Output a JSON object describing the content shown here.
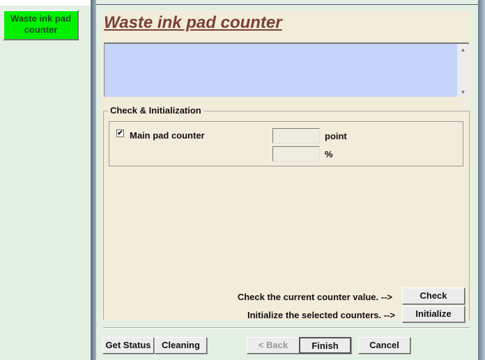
{
  "sidebar": {
    "waste_ink_button": "Waste ink pad counter"
  },
  "dialog": {
    "title": "Waste ink pad counter",
    "log_text": "",
    "group_label": "Check & Initialization",
    "main_pad": {
      "label": "Main pad counter",
      "checked": true,
      "point_value": "",
      "point_unit": "point",
      "percent_value": "",
      "percent_unit": "%"
    },
    "check_hint": "Check the current counter value. -->",
    "check_button": "Check",
    "init_hint": "Initialize the selected counters. -->",
    "init_button": "Initialize"
  },
  "footer": {
    "get_status": "Get Status",
    "cleaning": "Cleaning",
    "back": "< Back",
    "finish": "Finish",
    "cancel": "Cancel"
  },
  "icons": {
    "check_mark": "✔",
    "scroll_up": "▲",
    "scroll_down": "▼"
  }
}
